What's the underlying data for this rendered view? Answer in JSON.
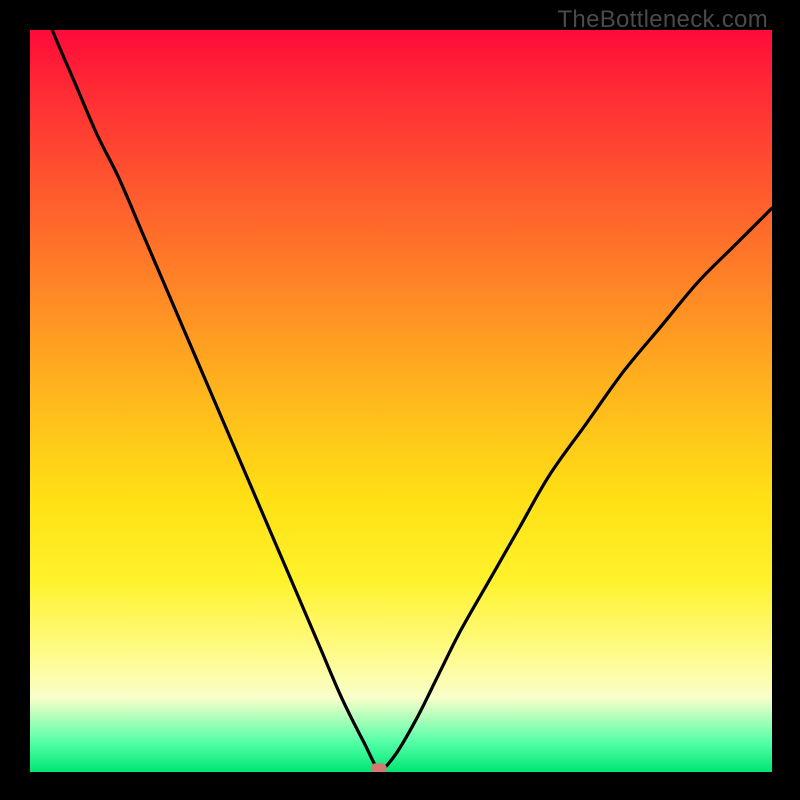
{
  "watermark": {
    "text": "TheBottleneck.com"
  },
  "accent_colors": {
    "curve_stroke": "#000000",
    "marker_fill": "#d47a6e",
    "gradient_top": "#ff0a3a",
    "gradient_bottom": "#00e676"
  },
  "chart_data": {
    "type": "line",
    "title": "",
    "xlabel": "",
    "ylabel": "",
    "xlim": [
      0,
      100
    ],
    "ylim": [
      0,
      100
    ],
    "grid": false,
    "legend": false,
    "note": "y is bottleneck % (0 = bottom/green, 100 = top/red). Curve dips to ~0 near x≈47.",
    "x": [
      0,
      3,
      6,
      9,
      12,
      15,
      18,
      21,
      24,
      27,
      30,
      33,
      36,
      39,
      42,
      45,
      47,
      49,
      52,
      55,
      58,
      62,
      66,
      70,
      75,
      80,
      85,
      90,
      95,
      100
    ],
    "values": [
      108,
      100,
      93,
      86,
      80,
      73,
      66,
      59,
      52,
      45,
      38,
      31,
      24,
      17,
      10,
      4,
      0.5,
      2,
      7,
      13,
      19,
      26,
      33,
      40,
      47,
      54,
      60,
      66,
      71,
      76
    ],
    "marker": {
      "x": 47,
      "y": 0.5
    }
  }
}
